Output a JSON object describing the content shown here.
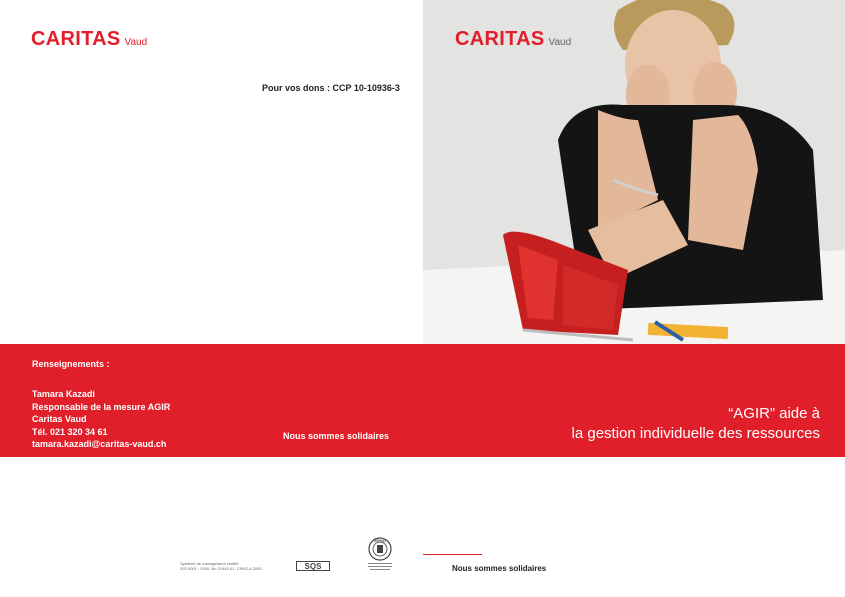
{
  "colors": {
    "brand_red": "#e01f2b",
    "text_dark": "#222222",
    "white": "#ffffff"
  },
  "logo": {
    "brand": "CARITAS",
    "sub": "Vaud"
  },
  "donation": "Pour vos dons : CCP 10-10936-3",
  "band": {
    "heading": "Renseignements :",
    "contact": [
      "Tamara Kazadi",
      "Responsable de la mesure AGIR",
      "Caritas Vaud",
      "Tél. 021 320 34 61",
      "tamara.kazadi@caritas-vaud.ch"
    ],
    "slogan": "Nous sommes solidaires",
    "title_line1": "“AGIR” aide à",
    "title_line2": "la gestion individuelle des ressources"
  },
  "footer": {
    "cert_line1": "Système de management certifié",
    "cert_line2": "ISO 9001 : 2000, No 21945-01, CRKS-A 2000",
    "sqs_label": "SQS",
    "zewo_label": "ZEWO",
    "slogan": "Nous sommes solidaires"
  },
  "photo": {
    "subject": "woman-with-empty-wallet"
  }
}
